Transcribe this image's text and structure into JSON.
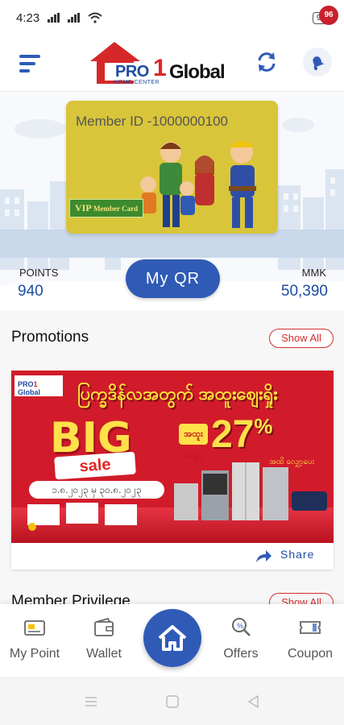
{
  "status_bar": {
    "time": "4:23",
    "battery": "95"
  },
  "header": {
    "logo": {
      "pro": "PRO",
      "one": "1",
      "global": "Global",
      "sub": "HOME CENTER"
    },
    "notification_count": "96"
  },
  "member_card": {
    "member_id": "Member ID -1000000100",
    "vip_label": "VIP",
    "vip_sub": "Member Card"
  },
  "stats": {
    "points_label": "POINTS",
    "points_value": "940",
    "mmk_label": "MMK",
    "mmk_value": "50,390",
    "qr_button": "My QR"
  },
  "promotions": {
    "title": "Promotions",
    "show_all": "Show All",
    "banner": {
      "logo_pro": "PRO",
      "logo_one": "1",
      "logo_global": "Global",
      "headline": "ပြက္ခဒိန်လအတွက် အထူးဈေးရှိုး",
      "big": "BIG",
      "sale": "sale",
      "date": "၁.၈.၂၀၂၃ မှ ၃၀.၈.၂၀၂၃",
      "discount_prefix": "အထူး လျှော့",
      "discount": "27",
      "discount_unit": "%",
      "discount_note": "အထိ လျှော့ပေး"
    },
    "share": "Share"
  },
  "member_privilege": {
    "title": "Member Privilege",
    "show_all": "Show All"
  },
  "bottom_nav": {
    "items": [
      {
        "label": "My Point",
        "icon": "points-card-icon"
      },
      {
        "label": "Wallet",
        "icon": "wallet-icon"
      },
      {
        "label": "",
        "icon": "home-icon"
      },
      {
        "label": "Offers",
        "icon": "search-offers-icon"
      },
      {
        "label": "Coupon",
        "icon": "coupon-icon"
      }
    ]
  },
  "colors": {
    "brand_blue": "#2f5bb7",
    "brand_red": "#d32f2f",
    "card_yellow": "#d9c53a"
  }
}
